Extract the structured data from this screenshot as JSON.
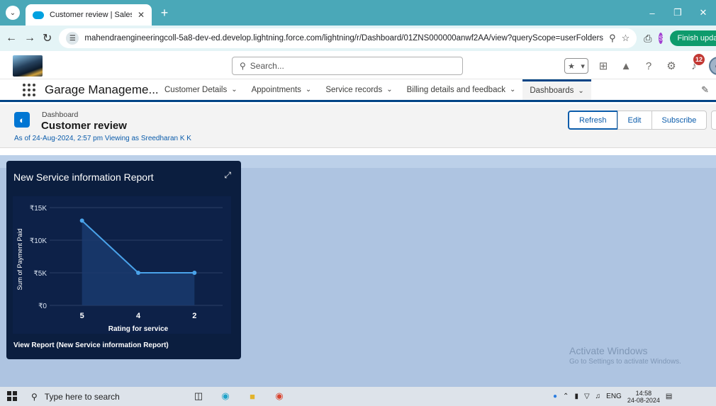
{
  "browser": {
    "tab_title": "Customer review | Salesforce",
    "url": "mahendraengineeringcoll-5a8-dev-ed.develop.lightning.force.com/lightning/r/Dashboard/01ZNS000000anwf2AA/view?queryScope=userFolders",
    "profile_initial": "S",
    "finish_update_label": "Finish update"
  },
  "header": {
    "search_placeholder": "Search...",
    "notification_count": "12"
  },
  "app": {
    "name": "Garage Manageme...",
    "nav": [
      {
        "label": "Customer Details"
      },
      {
        "label": "Appointments"
      },
      {
        "label": "Service records"
      },
      {
        "label": "Billing details and feedback"
      },
      {
        "label": "Dashboards"
      }
    ],
    "active_nav": "Dashboards"
  },
  "page": {
    "object_label": "Dashboard",
    "title": "Customer review",
    "as_of": "As of 24-Aug-2024, 2:57 pm Viewing as Sreedharan K K",
    "buttons": {
      "refresh": "Refresh",
      "edit": "Edit",
      "subscribe": "Subscribe"
    }
  },
  "widget": {
    "title": "New Service information Report",
    "view_report": "View Report (New Service information Report)"
  },
  "chart_data": {
    "type": "area",
    "categories": [
      "5",
      "4",
      "2"
    ],
    "values": [
      13000,
      5000,
      5000
    ],
    "xlabel": "Rating for service",
    "ylabel": "Sum of Payment Paid",
    "ylim": [
      0,
      15000
    ],
    "yticks": [
      0,
      5000,
      10000,
      15000
    ],
    "ytick_labels": [
      "₹0",
      "₹5K",
      "₹10K",
      "₹15K"
    ],
    "colors": {
      "line": "#4aa3ea",
      "fill": "#1a3a6e",
      "point": "#4aa3ea"
    }
  },
  "watermark": {
    "title": "Activate Windows",
    "subtitle": "Go to Settings to activate Windows."
  },
  "taskbar": {
    "search_placeholder": "Type here to search",
    "language": "ENG",
    "time": "14:58",
    "date": "24-08-2024"
  }
}
